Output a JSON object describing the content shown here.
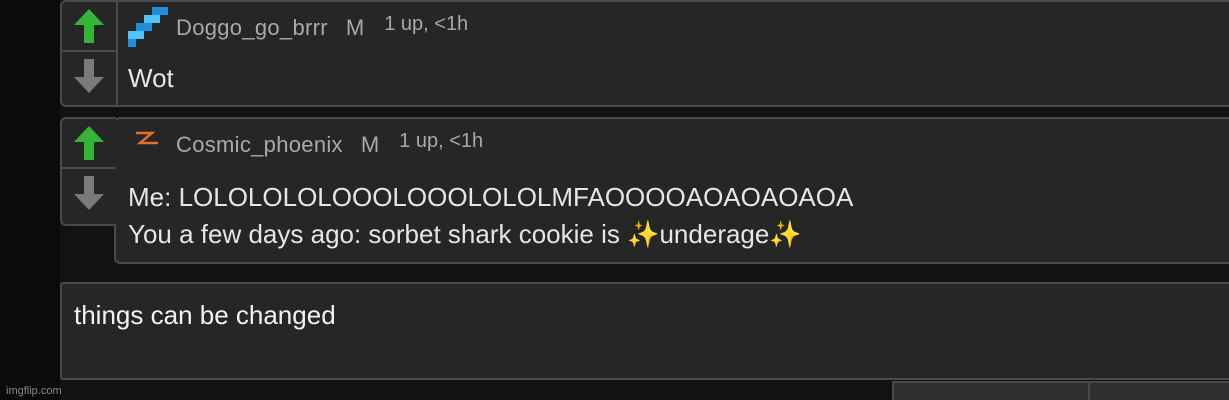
{
  "comments": [
    {
      "username": "Doggo_go_brrr",
      "badge": "M",
      "meta": "1 up, <1h",
      "avatar_icon": "pixel-sword-icon",
      "lines": [
        "Wot"
      ]
    },
    {
      "username": "Cosmic_phoenix",
      "badge": "M",
      "meta": "1 up, <1h",
      "avatar_icon": "lightning-icon",
      "lines": [
        "Me: LOLOLOLOLOOOLOOOLOLOLMFAOOOOAOAOAOAOA",
        "You a few days ago: sorbet shark cookie is ✨underage✨"
      ]
    }
  ],
  "reply": {
    "value": "things can be changed"
  },
  "watermark": "imgflip.com",
  "colors": {
    "upvote": "#35b535",
    "downvote": "#7a7a7a",
    "panel": "#262626",
    "border": "#4a4a4a"
  }
}
